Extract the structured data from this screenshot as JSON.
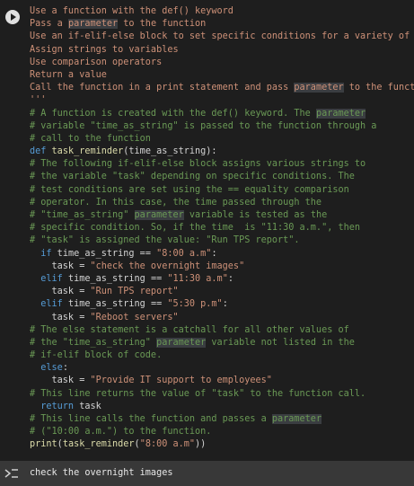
{
  "cell": {
    "run_button": "play-icon",
    "lines": [
      [
        {
          "t": "Use a function with the def() keyword",
          "c": "s"
        }
      ],
      [
        {
          "t": "Pass a ",
          "c": "s"
        },
        {
          "t": "parameter",
          "c": "s hl"
        },
        {
          "t": " to the function",
          "c": "s"
        }
      ],
      [
        {
          "t": "Use an if-elif-else block to set specific conditions for a variety of acti",
          "c": "s"
        }
      ],
      [
        {
          "t": "Assign strings to variables",
          "c": "s"
        }
      ],
      [
        {
          "t": "Use comparison operators",
          "c": "s"
        }
      ],
      [
        {
          "t": "Return a value",
          "c": "s"
        }
      ],
      [
        {
          "t": "Call the function in a print statement and pass ",
          "c": "s"
        },
        {
          "t": "parameter",
          "c": "s hl"
        },
        {
          "t": " to the function",
          "c": "s"
        }
      ],
      [
        {
          "t": "'''",
          "c": "s"
        }
      ],
      [
        {
          "t": "# A function is created with the def() keyword. The ",
          "c": "c"
        },
        {
          "t": "parameter",
          "c": "c hl"
        }
      ],
      [
        {
          "t": "# variable \"time_as_string\" is passed to the function through a",
          "c": "c"
        }
      ],
      [
        {
          "t": "# call to the function",
          "c": "c"
        }
      ],
      [
        {
          "t": "def",
          "c": "k"
        },
        {
          "t": " "
        },
        {
          "t": "task_reminder",
          "c": "f"
        },
        {
          "t": "(time_as_string):"
        }
      ],
      [
        {
          "t": "# The following if-elif-else block assigns various strings to",
          "c": "c"
        }
      ],
      [
        {
          "t": "# the variable \"task\" depending on specific conditions. The",
          "c": "c"
        }
      ],
      [
        {
          "t": "# test conditions are set using the == equality comparison",
          "c": "c"
        }
      ],
      [
        {
          "t": "# operator. In this case, the time passed through the",
          "c": "c"
        }
      ],
      [
        {
          "t": "# \"time_as_string\" ",
          "c": "c"
        },
        {
          "t": "parameter",
          "c": "c hl"
        },
        {
          "t": " variable is tested as the",
          "c": "c"
        }
      ],
      [
        {
          "t": "# specific condition. So, if the time  is \"11:30 a.m.\", then",
          "c": "c"
        }
      ],
      [
        {
          "t": "# \"task\" is assigned the value: \"Run TPS report\".",
          "c": "c"
        }
      ],
      [
        {
          "t": "  if",
          "c": "k"
        },
        {
          "t": " time_as_string == "
        },
        {
          "t": "\"8:00 a.m\"",
          "c": "s"
        },
        {
          "t": ":"
        }
      ],
      [
        {
          "t": "    task = "
        },
        {
          "t": "\"check the overnight images\"",
          "c": "s"
        }
      ],
      [
        {
          "t": "  elif",
          "c": "k"
        },
        {
          "t": " time_as_string == "
        },
        {
          "t": "\"11:30 a.m\"",
          "c": "s"
        },
        {
          "t": ":"
        }
      ],
      [
        {
          "t": "    task = "
        },
        {
          "t": "\"Run TPS report\"",
          "c": "s"
        }
      ],
      [
        {
          "t": "  elif",
          "c": "k"
        },
        {
          "t": " time_as_string == "
        },
        {
          "t": "\"5:30 p.m\"",
          "c": "s"
        },
        {
          "t": ":"
        }
      ],
      [
        {
          "t": "    task = "
        },
        {
          "t": "\"Reboot servers\"",
          "c": "s"
        }
      ],
      [
        {
          "t": "# The else statement is a catchall for all other values of",
          "c": "c"
        }
      ],
      [
        {
          "t": "# the \"time_as_string\" ",
          "c": "c"
        },
        {
          "t": "parameter",
          "c": "c hl"
        },
        {
          "t": " variable not listed in the",
          "c": "c"
        }
      ],
      [
        {
          "t": "# if-elif block of code.",
          "c": "c"
        }
      ],
      [
        {
          "t": "  else",
          "c": "k"
        },
        {
          "t": ":"
        }
      ],
      [
        {
          "t": "    task = "
        },
        {
          "t": "\"Provide IT support to employees\"",
          "c": "s"
        }
      ],
      [
        {
          "t": "# This line returns the value of \"task\" to the function call.",
          "c": "c"
        }
      ],
      [
        {
          "t": "  return",
          "c": "k"
        },
        {
          "t": " task"
        }
      ],
      [
        {
          "t": "# This line calls the function and passes a ",
          "c": "c"
        },
        {
          "t": "parameter",
          "c": "c hl"
        }
      ],
      [
        {
          "t": "# (\"10:00 a.m.\") to the function.",
          "c": "c"
        }
      ],
      [
        {
          "t": "print",
          "c": "f"
        },
        {
          "t": "("
        },
        {
          "t": "task_reminder",
          "c": "f"
        },
        {
          "t": "("
        },
        {
          "t": "\"8:00 a.m\"",
          "c": "s"
        },
        {
          "t": "))"
        }
      ]
    ]
  },
  "output": {
    "icon": "output-toggle-icon",
    "text": "check the overnight images"
  },
  "colors": {
    "background": "#1e1e1e",
    "comment": "#6a9955",
    "string": "#ce9178",
    "keyword": "#569cd6",
    "function": "#dcdcaa",
    "output_bar": "#383838"
  }
}
